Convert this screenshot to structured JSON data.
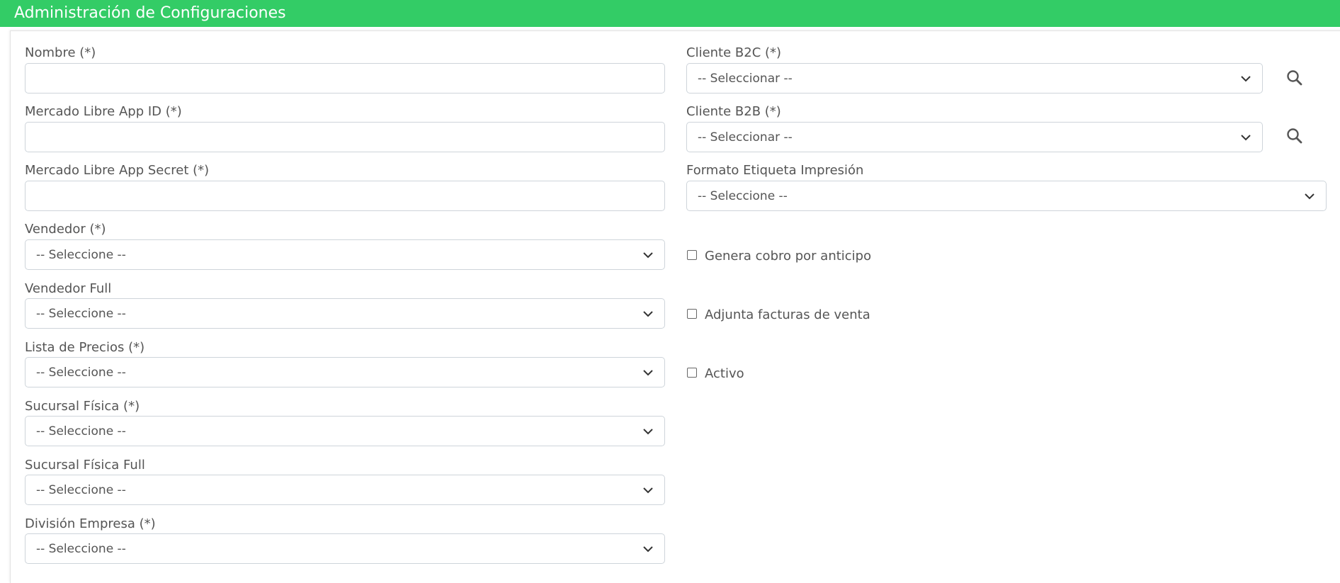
{
  "header": {
    "title": "Administración de Configuraciones"
  },
  "left": {
    "nombre": {
      "label": "Nombre (*)",
      "value": ""
    },
    "app_id": {
      "label": "Mercado Libre App ID (*)",
      "value": ""
    },
    "app_secret": {
      "label": "Mercado Libre App Secret (*)",
      "value": ""
    },
    "vendedor": {
      "label": "Vendedor (*)",
      "selected": "-- Seleccione --"
    },
    "vendedor_full": {
      "label": "Vendedor Full",
      "selected": "-- Seleccione --"
    },
    "lista_precios": {
      "label": "Lista de Precios (*)",
      "selected": "-- Seleccione --"
    },
    "sucursal_fisica": {
      "label": "Sucursal Física (*)",
      "selected": "-- Seleccione --"
    },
    "sucursal_fisica_full": {
      "label": "Sucursal Física Full",
      "selected": "-- Seleccione --"
    },
    "division_empresa": {
      "label": "División Empresa (*)",
      "selected": "-- Seleccione --"
    }
  },
  "right": {
    "cliente_b2c": {
      "label": "Cliente B2C (*)",
      "selected": "-- Seleccionar --"
    },
    "cliente_b2b": {
      "label": "Cliente B2B (*)",
      "selected": "-- Seleccionar --"
    },
    "formato_etiqueta": {
      "label": "Formato Etiqueta Impresión",
      "selected": "-- Seleccione --"
    },
    "checkboxes": [
      {
        "label": "Genera cobro por anticipo",
        "checked": false
      },
      {
        "label": "Adjunta facturas de venta",
        "checked": false
      },
      {
        "label": "Activo",
        "checked": false
      }
    ]
  },
  "icons": {
    "search": "search-icon",
    "chevron": "chevron-down-icon"
  },
  "colors": {
    "header_bg": "#33cc66",
    "border": "#ced4da",
    "text": "#555555"
  }
}
